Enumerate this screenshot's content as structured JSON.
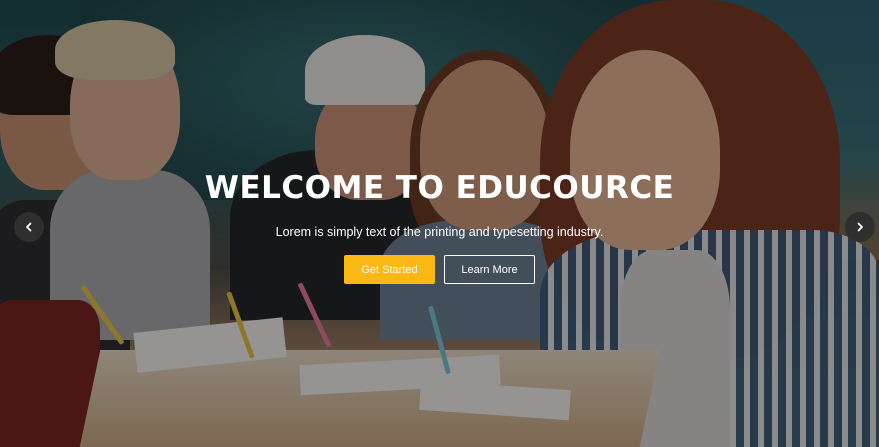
{
  "hero": {
    "title": "WELCOME TO EDUCOURCE",
    "subtitle": "Lorem is simply text of the printing and typesetting industry.",
    "primary_button": "Get Started",
    "secondary_button": "Learn More"
  },
  "carousel": {
    "prev_icon": "chevron-left-icon",
    "next_icon": "chevron-right-icon"
  },
  "colors": {
    "accent": "#fbb714",
    "overlay": "rgba(0,0,0,0.38)",
    "arrow_bg": "#2f2f2f"
  }
}
